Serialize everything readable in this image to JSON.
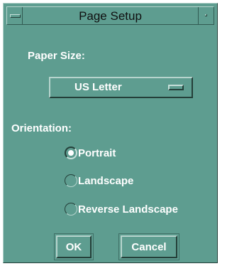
{
  "window": {
    "title": "Page Setup"
  },
  "paper_size": {
    "label": "Paper Size:",
    "selected": "US Letter"
  },
  "orientation": {
    "label": "Orientation:",
    "options": [
      {
        "label": "Portrait",
        "selected": true
      },
      {
        "label": "Landscape",
        "selected": false
      },
      {
        "label": "Reverse Landscape",
        "selected": false
      }
    ]
  },
  "buttons": {
    "ok": "OK",
    "cancel": "Cancel"
  },
  "colors": {
    "background": "#5e9d90",
    "text": "#ffffff",
    "title_text": "#101010"
  },
  "icons": {
    "window_menu": "window-menu-icon",
    "minimize": "minimize-icon",
    "option_indicator": "option-menu-indicator-icon"
  }
}
